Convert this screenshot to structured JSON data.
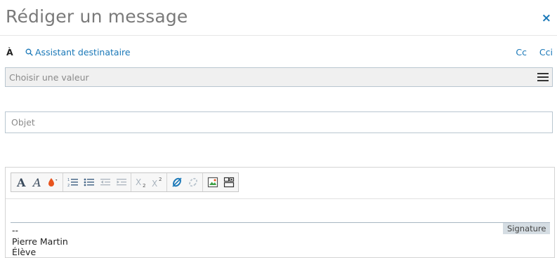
{
  "header": {
    "title": "Rédiger un message",
    "close_symbol": "×"
  },
  "recipients": {
    "to_label": "À",
    "assistant_label": "Assistant destinataire",
    "cc_label": "Cc",
    "cci_label": "Cci",
    "select_placeholder": "Choisir une valeur"
  },
  "subject": {
    "placeholder": "Objet",
    "value": ""
  },
  "toolbar": {
    "buttons": [
      "bold",
      "italic",
      "text-color",
      "ordered-list",
      "unordered-list",
      "outdent",
      "indent",
      "subscript",
      "superscript",
      "insert-link",
      "remove-link",
      "insert-image",
      "insert-template"
    ]
  },
  "editor": {
    "signature_badge": "Signature",
    "signature_lines": [
      "--",
      "Pierre Martin",
      "Élève"
    ]
  },
  "colors": {
    "accent": "#1a78b8",
    "title": "#7a7a7a",
    "border": "#b9c6d0"
  }
}
